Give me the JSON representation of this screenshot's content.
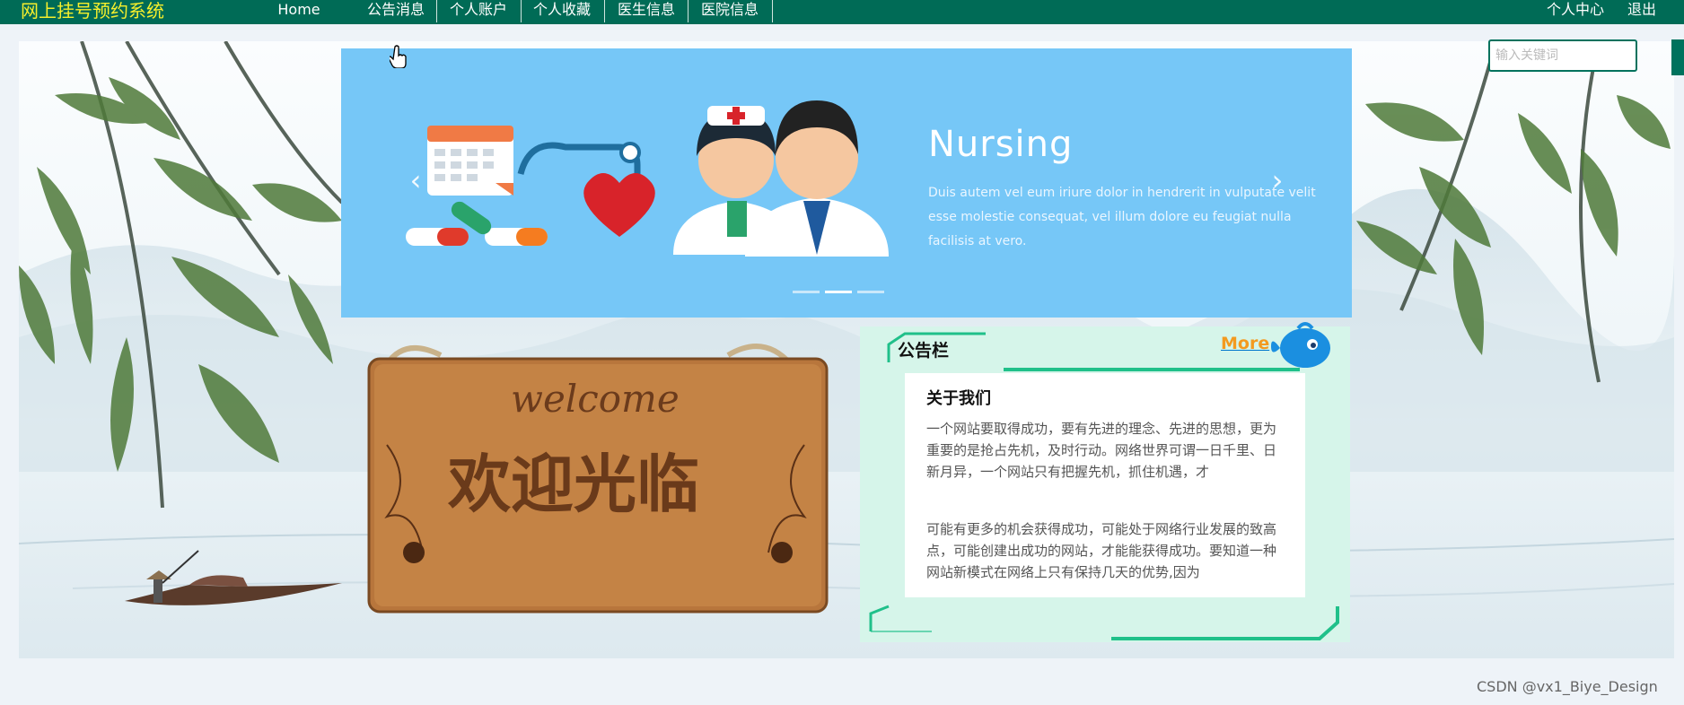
{
  "nav": {
    "brand": "网上挂号预约系统",
    "items": [
      "Home",
      "公告消息",
      "个人账户",
      "个人收藏",
      "医生信息",
      "医院信息"
    ],
    "right": [
      "个人中心",
      "退出"
    ]
  },
  "search": {
    "placeholder": "输入关键词"
  },
  "banner": {
    "title": "Nursing",
    "text": "Duis autem vel eum iriure dolor in hendrerit in vulputate velit esse molestie consequat, vel illum dolore eu feugiat nulla facilisis at vero.",
    "prev": "‹",
    "next": "›",
    "slide_count": 3,
    "active_slide": 2
  },
  "sign": {
    "welcome": "welcome",
    "greeting": "欢迎光临"
  },
  "notice": {
    "title": "公告栏",
    "more": "More",
    "card_title": "关于我们",
    "paragraphs": [
      "一个网站要取得成功，要有先进的理念、先进的思想，更为重要的是抢占先机，及时行动。网络世界可谓一日千里、日新月异，一个网站只有把握先机，抓住机遇，才",
      "可能有更多的机会获得成功，可能处于网络行业发展的致高点，可能创建出成功的网站，才能能获得成功。要知道一种网站新模式在网络上只有保持几天的优势,因为"
    ]
  },
  "watermark": "CSDN @vx1_Biye_Design",
  "colors": {
    "nav_bg": "#006b56",
    "brand": "#f6ef2c",
    "banner_bg": "#76c7f7",
    "notice_bg": "#d6f5ea",
    "more": "#f39a20"
  }
}
